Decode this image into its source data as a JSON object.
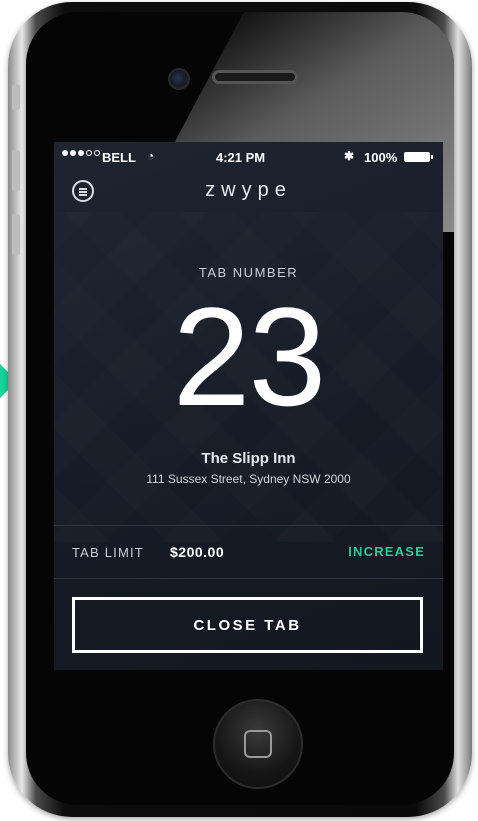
{
  "status_bar": {
    "carrier": "BELL",
    "time": "4:21 PM",
    "battery": "100%"
  },
  "header": {
    "title": "zwype"
  },
  "tab": {
    "label": "TAB NUMBER",
    "number": "23"
  },
  "venue": {
    "name": "The Slipp Inn",
    "address": "111 Sussex Street, Sydney NSW 2000"
  },
  "limit": {
    "label": "TAB LIMIT",
    "value": "$200.00",
    "action": "INCREASE"
  },
  "actions": {
    "close_tab": "CLOSE TAB"
  },
  "colors": {
    "accent": "#1fcf97",
    "screen_bg": "#1a202b"
  },
  "icons": [
    "menu-icon",
    "wifi-icon",
    "bluetooth-icon",
    "battery-icon",
    "signal-icon"
  ]
}
